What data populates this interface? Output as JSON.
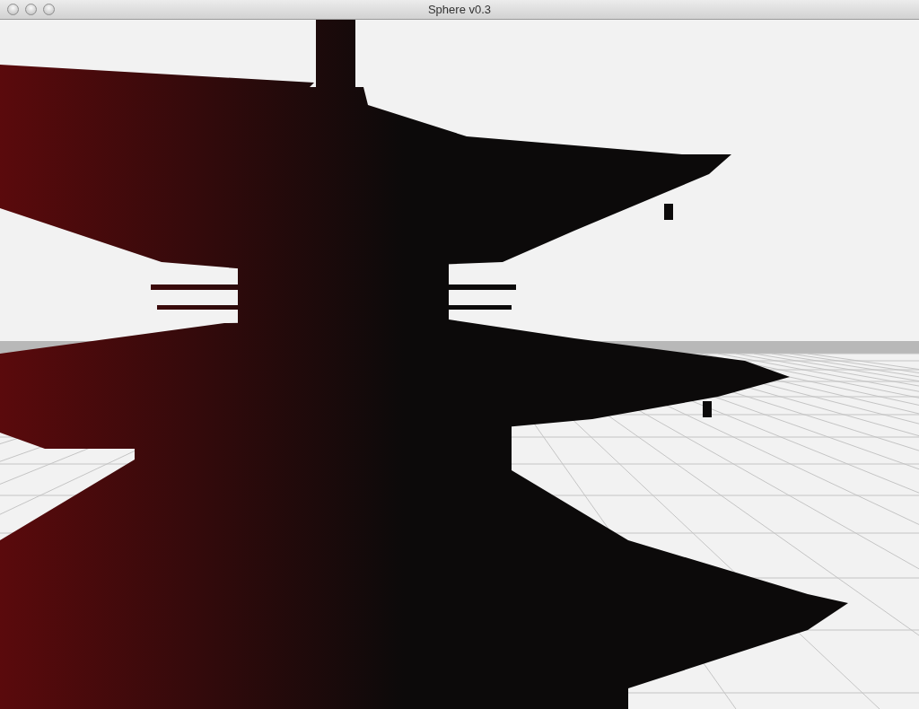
{
  "window": {
    "title": "Sphere v0.3"
  }
}
